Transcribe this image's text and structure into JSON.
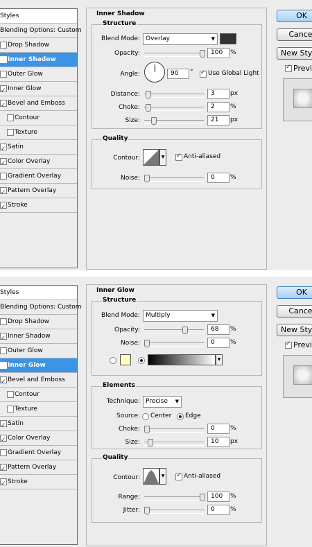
{
  "panel1": {
    "styles_header": "Styles",
    "blending_options": "Blending Options: Custom",
    "style_items": [
      {
        "label": "Drop Shadow",
        "checked": false
      },
      {
        "label": "Inner Shadow",
        "checked": true
      },
      {
        "label": "Outer Glow",
        "checked": false
      },
      {
        "label": "Inner Glow",
        "checked": true
      },
      {
        "label": "Bevel and Emboss",
        "checked": true
      },
      {
        "label": "Contour",
        "checked": false
      },
      {
        "label": "Texture",
        "checked": false
      },
      {
        "label": "Satin",
        "checked": true
      },
      {
        "label": "Color Overlay",
        "checked": true
      },
      {
        "label": "Gradient Overlay",
        "checked": false
      },
      {
        "label": "Pattern Overlay",
        "checked": true
      },
      {
        "label": "Stroke",
        "checked": true
      }
    ],
    "selected_index": 1,
    "section_title": "Inner Shadow",
    "structure": {
      "title": "Structure",
      "blend_mode_label": "Blend Mode:",
      "blend_mode_value": "Overlay",
      "shadow_color": "#333333",
      "opacity_label": "Opacity:",
      "opacity_value": "100",
      "angle_label": "Angle:",
      "angle_value": "90",
      "degree_symbol": "°",
      "global_light_label": "Use Global Light",
      "global_light_checked": true,
      "distance_label": "Distance:",
      "distance_value": "3",
      "choke_label": "Choke:",
      "choke_value": "2",
      "size_label": "Size:",
      "size_value": "21"
    },
    "quality": {
      "title": "Quality",
      "contour_label": "Contour:",
      "anti_aliased_label": "Anti-aliased",
      "anti_aliased_checked": true,
      "noise_label": "Noise:",
      "noise_value": "0"
    },
    "units": {
      "percent": "%",
      "px": "px"
    },
    "buttons": {
      "ok": "OK",
      "cancel": "Cancel",
      "new_style": "New Style...",
      "preview": "Preview"
    },
    "preview_checked": true
  },
  "panel2": {
    "styles_header": "Styles",
    "blending_options": "Blending Options: Custom",
    "style_items": [
      {
        "label": "Drop Shadow",
        "checked": false
      },
      {
        "label": "Inner Shadow",
        "checked": true
      },
      {
        "label": "Outer Glow",
        "checked": false
      },
      {
        "label": "Inner Glow",
        "checked": true
      },
      {
        "label": "Bevel and Emboss",
        "checked": true
      },
      {
        "label": "Contour",
        "checked": false
      },
      {
        "label": "Texture",
        "checked": false
      },
      {
        "label": "Satin",
        "checked": true
      },
      {
        "label": "Color Overlay",
        "checked": true
      },
      {
        "label": "Gradient Overlay",
        "checked": false
      },
      {
        "label": "Pattern Overlay",
        "checked": true
      },
      {
        "label": "Stroke",
        "checked": true
      }
    ],
    "selected_index": 3,
    "section_title": "Inner Glow",
    "structure": {
      "title": "Structure",
      "blend_mode_label": "Blend Mode:",
      "blend_mode_value": "Multiply",
      "opacity_label": "Opacity:",
      "opacity_value": "68",
      "noise_label": "Noise:",
      "noise_value": "0",
      "glow_color": "#ffffc0",
      "gradient_from": "#000000",
      "gradient_to": "#ffffff"
    },
    "elements": {
      "title": "Elements",
      "technique_label": "Technique:",
      "technique_value": "Precise",
      "source_label": "Source:",
      "source_center": "Center",
      "source_edge": "Edge",
      "choke_label": "Choke:",
      "choke_value": "0",
      "size_label": "Size:",
      "size_value": "10"
    },
    "quality": {
      "title": "Quality",
      "contour_label": "Contour:",
      "anti_aliased_label": "Anti-aliased",
      "anti_aliased_checked": true,
      "range_label": "Range:",
      "range_value": "100",
      "jitter_label": "Jitter:",
      "jitter_value": "0"
    },
    "units": {
      "percent": "%",
      "px": "px"
    },
    "buttons": {
      "ok": "OK",
      "cancel": "Cancel",
      "new_style": "New Style...",
      "preview": "Preview"
    },
    "preview_checked": true
  },
  "accent_color": "#3c94e6"
}
